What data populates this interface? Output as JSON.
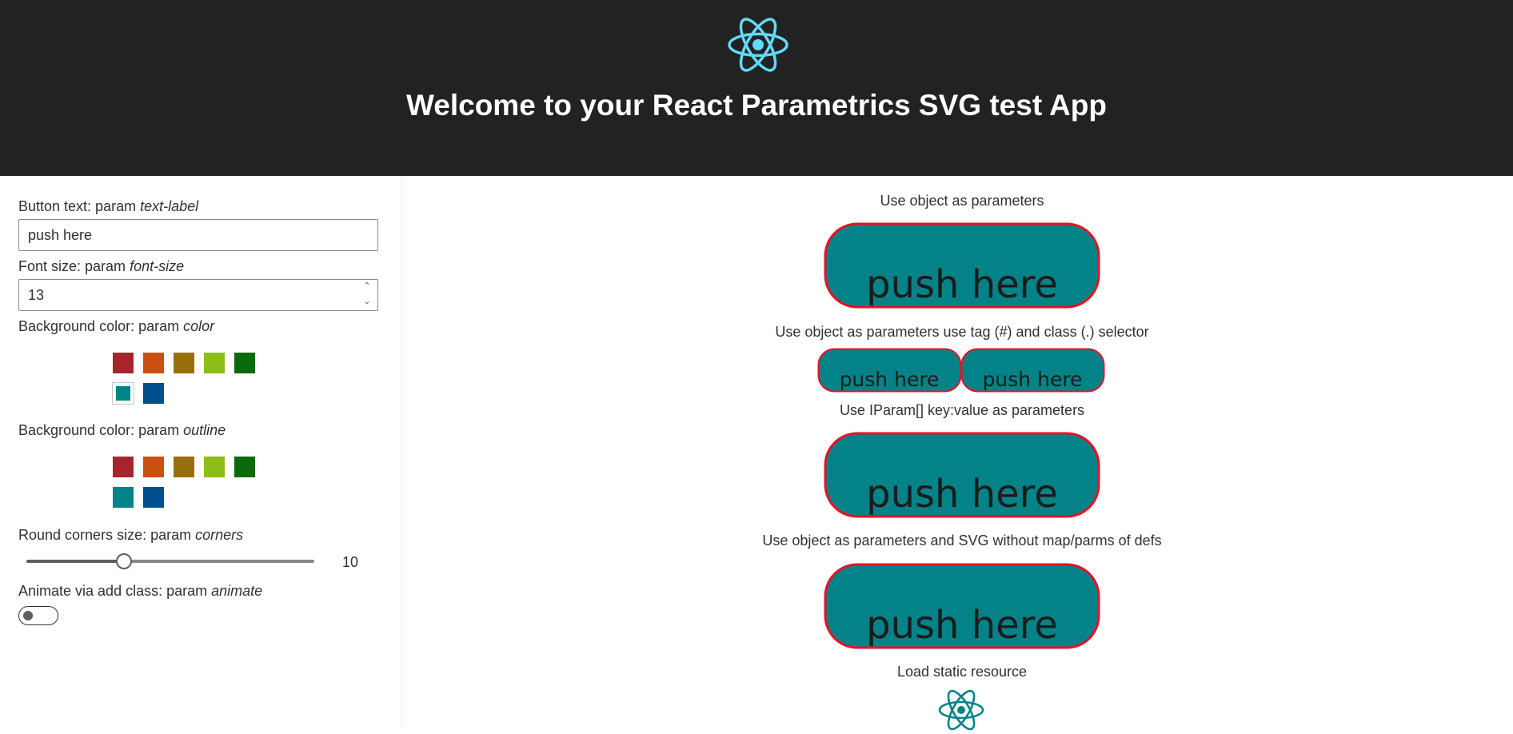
{
  "header": {
    "title": "Welcome to your React Parametrics SVG test App",
    "logo_icon": "react-atom-icon",
    "logo_color": "#61dafb"
  },
  "controls": {
    "text_label": {
      "prefix": "Button text: param ",
      "param": "text-label",
      "value": "push here"
    },
    "font_size": {
      "prefix": "Font size: param ",
      "param": "font-size",
      "value": "13"
    },
    "color": {
      "prefix": "Background color: param ",
      "param": "color"
    },
    "outline": {
      "prefix": "Background color: param ",
      "param": "outline"
    },
    "corners": {
      "prefix": "Round corners size: param ",
      "param": "corners",
      "value": "10",
      "fraction": 0.34
    },
    "animate": {
      "prefix": "Animate via add class: param ",
      "param": "animate",
      "checked": false
    }
  },
  "swatches": {
    "color_palette": [
      "#a4262c",
      "#ca5010",
      "#986f0b",
      "#8cbd18",
      "#0b6a0b",
      "#038387",
      "#004e8c"
    ],
    "color_selected_index": 5,
    "outline_palette": [
      "#a4262c",
      "#ca5010",
      "#986f0b",
      "#8cbd18",
      "#0b6a0b",
      "#038387",
      "#004e8c"
    ],
    "outline_selected_index": -1
  },
  "demos": {
    "section1": "Use object as parameters",
    "section2": "Use object as parameters use tag (#) and class (.) selector",
    "section3": "Use IParam[] key:value as parameters",
    "section4": "Use object as parameters and SVG without map/parms of defs",
    "section5": "Load static resource",
    "button_text": "push here",
    "button_fill": "#038387",
    "button_outline": "#e81123",
    "static_icon_color": "#038387"
  }
}
